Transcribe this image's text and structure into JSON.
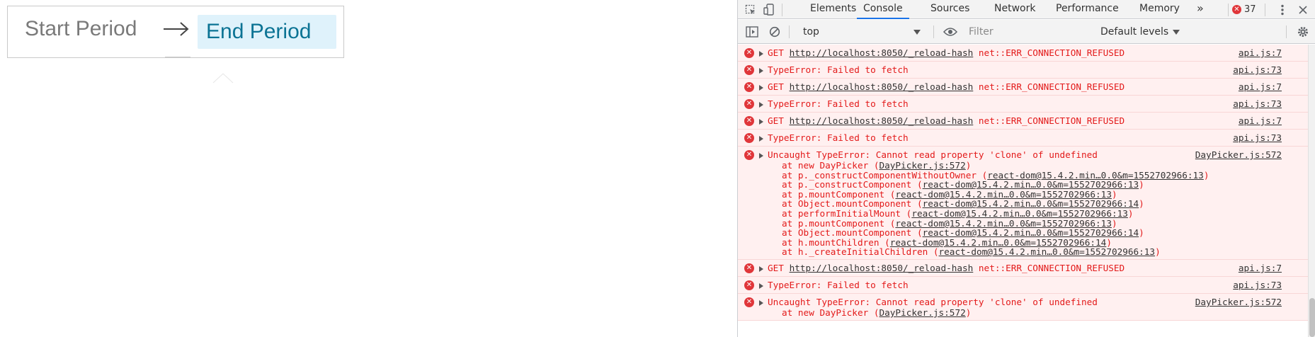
{
  "app": {
    "start_period": "Start Period",
    "end_period": "End Period"
  },
  "devtools": {
    "tabs": [
      "Elements",
      "Console",
      "Sources",
      "Network",
      "Performance",
      "Memory"
    ],
    "more_tabs": "»",
    "error_count": "37",
    "context": "top",
    "filter_placeholder": "Filter",
    "levels": "Default levels",
    "colors": {
      "accent": "#1a73e8",
      "error_text": "#e31a1a",
      "error_bg": "#fff0f0"
    },
    "messages": [
      {
        "type": "single",
        "text": "GET ",
        "link": "http://localhost:8050/_reload-hash",
        "rest": " net::ERR_CONNECTION_REFUSED",
        "source": "api.js:7"
      },
      {
        "type": "single",
        "text": "TypeError: Failed to fetch",
        "link": "",
        "rest": "",
        "source": "api.js:73"
      },
      {
        "type": "single",
        "text": "GET ",
        "link": "http://localhost:8050/_reload-hash",
        "rest": " net::ERR_CONNECTION_REFUSED",
        "source": "api.js:7"
      },
      {
        "type": "single",
        "text": "TypeError: Failed to fetch",
        "link": "",
        "rest": "",
        "source": "api.js:73"
      },
      {
        "type": "single",
        "text": "GET ",
        "link": "http://localhost:8050/_reload-hash",
        "rest": " net::ERR_CONNECTION_REFUSED",
        "source": "api.js:7"
      },
      {
        "type": "single",
        "text": "TypeError: Failed to fetch",
        "link": "",
        "rest": "",
        "source": "api.js:73"
      },
      {
        "type": "stack",
        "text": "Uncaught TypeError: Cannot read property 'clone' of undefined",
        "source": "DayPicker.js:572",
        "frames": [
          {
            "fn": "at new DayPicker (",
            "loc": "DayPicker.js:572",
            "end": ")"
          },
          {
            "fn": "at p._constructComponentWithoutOwner (",
            "loc": "react-dom@15.4.2.min…0.0&m=1552702966:13",
            "end": ")"
          },
          {
            "fn": "at p._constructComponent (",
            "loc": "react-dom@15.4.2.min…0.0&m=1552702966:13",
            "end": ")"
          },
          {
            "fn": "at p.mountComponent (",
            "loc": "react-dom@15.4.2.min…0.0&m=1552702966:13",
            "end": ")"
          },
          {
            "fn": "at Object.mountComponent (",
            "loc": "react-dom@15.4.2.min…0.0&m=1552702966:14",
            "end": ")"
          },
          {
            "fn": "at performInitialMount (",
            "loc": "react-dom@15.4.2.min…0.0&m=1552702966:13",
            "end": ")"
          },
          {
            "fn": "at p.mountComponent (",
            "loc": "react-dom@15.4.2.min…0.0&m=1552702966:13",
            "end": ")"
          },
          {
            "fn": "at Object.mountComponent (",
            "loc": "react-dom@15.4.2.min…0.0&m=1552702966:14",
            "end": ")"
          },
          {
            "fn": "at h.mountChildren (",
            "loc": "react-dom@15.4.2.min…0.0&m=1552702966:14",
            "end": ")"
          },
          {
            "fn": "at h._createInitialChildren (",
            "loc": "react-dom@15.4.2.min…0.0&m=1552702966:13",
            "end": ")"
          }
        ]
      },
      {
        "type": "single",
        "text": "GET ",
        "link": "http://localhost:8050/_reload-hash",
        "rest": " net::ERR_CONNECTION_REFUSED",
        "source": "api.js:7"
      },
      {
        "type": "single",
        "text": "TypeError: Failed to fetch",
        "link": "",
        "rest": "",
        "source": "api.js:73"
      },
      {
        "type": "stack",
        "text": "Uncaught TypeError: Cannot read property 'clone' of undefined",
        "source": "DayPicker.js:572",
        "frames": [
          {
            "fn": "at new DayPicker (",
            "loc": "DayPicker.js:572",
            "end": ")"
          }
        ]
      }
    ]
  }
}
